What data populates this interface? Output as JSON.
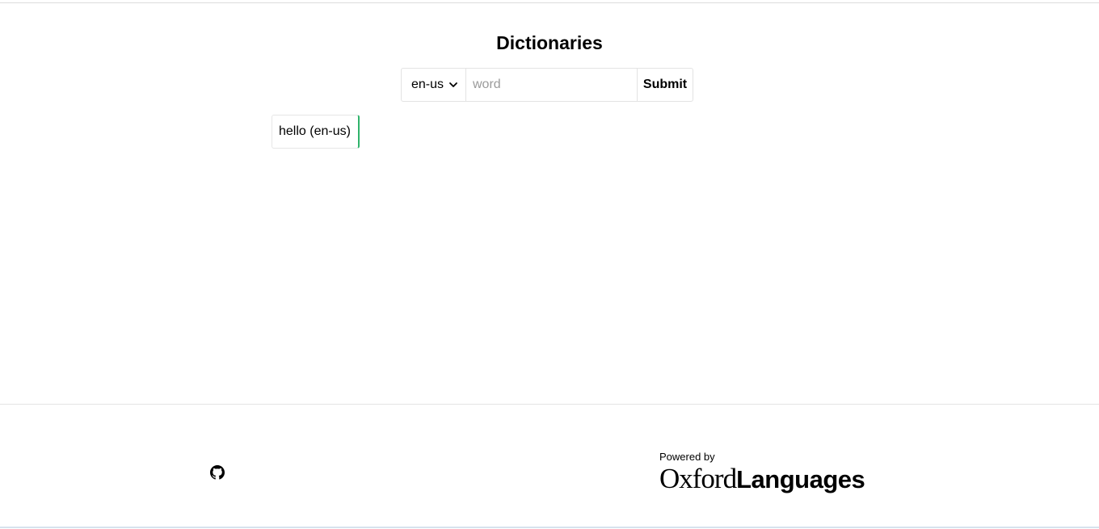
{
  "header": {
    "title": "Dictionaries"
  },
  "search": {
    "language_selected": "en-us",
    "word_value": "",
    "word_placeholder": "word",
    "submit_label": "Submit"
  },
  "history": {
    "items": [
      {
        "label": "hello (en-us)"
      }
    ],
    "accent_color": "#2fb36b"
  },
  "footer": {
    "github_icon": "github-icon",
    "powered_by": "Powered by",
    "brand_oxford": "Oxford",
    "brand_languages": "Languages"
  }
}
